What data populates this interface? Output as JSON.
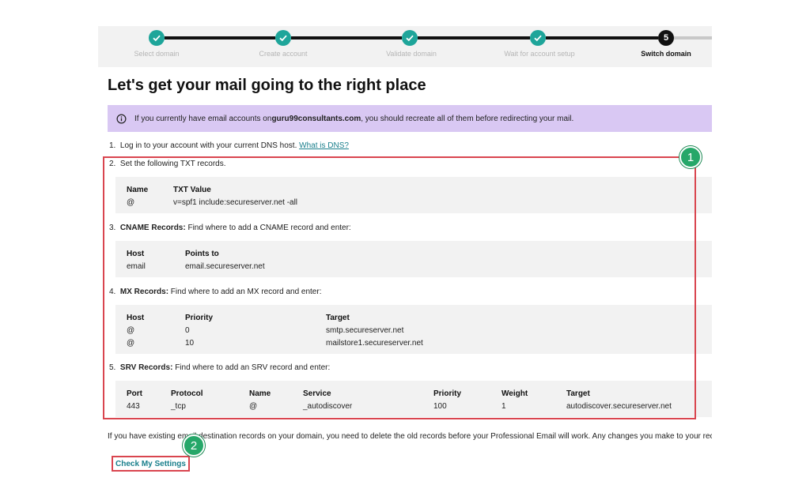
{
  "stepper": {
    "steps": [
      {
        "label": "Select domain",
        "state": "done"
      },
      {
        "label": "Create account",
        "state": "done"
      },
      {
        "label": "Validate domain",
        "state": "done"
      },
      {
        "label": "Wait for account setup",
        "state": "done"
      },
      {
        "label": "Switch domain",
        "state": "current",
        "number": "5"
      }
    ],
    "icon": "check-icon"
  },
  "page_title": "Let's get your mail going to the right place",
  "banner": {
    "icon": "info-icon",
    "prefix": "If you currently have email accounts on ",
    "domain": "guru99consultants.com",
    "suffix": ", you should recreate all of them before redirecting your mail."
  },
  "steps": {
    "s1": {
      "num": "1.",
      "text": "Log in to your account with your current DNS host. ",
      "link": "What is DNS?"
    },
    "s2": {
      "num": "2.",
      "text": "Set the following TXT records."
    },
    "s3": {
      "num": "3.",
      "bold": "CNAME Records:",
      "text": " Find where to add a CNAME record and enter:"
    },
    "s4": {
      "num": "4.",
      "bold": "MX Records:",
      "text": " Find where to add an MX record and enter:"
    },
    "s5": {
      "num": "5.",
      "bold": "SRV Records:",
      "text": " Find where to add an SRV record and enter:"
    }
  },
  "txt_table": {
    "headers": [
      "Name",
      "TXT Value"
    ],
    "rows": [
      [
        "@",
        "v=spf1 include:secureserver.net -all"
      ]
    ]
  },
  "cname_table": {
    "headers": [
      "Host",
      "Points to"
    ],
    "rows": [
      [
        "email",
        "email.secureserver.net"
      ]
    ]
  },
  "mx_table": {
    "headers": [
      "Host",
      "Priority",
      "Target"
    ],
    "rows": [
      [
        "@",
        "0",
        "smtp.secureserver.net"
      ],
      [
        "@",
        "10",
        "mailstore1.secureserver.net"
      ]
    ]
  },
  "srv_table": {
    "headers": [
      "Port",
      "Protocol",
      "Name",
      "Service",
      "Priority",
      "Weight",
      "Target"
    ],
    "rows": [
      [
        "443",
        "_tcp",
        "@",
        "_autodiscover",
        "100",
        "1",
        "autodiscover.secureserver.net"
      ]
    ]
  },
  "annotations": {
    "badge1": "1",
    "badge2": "2"
  },
  "footer": "If you have existing email destination records on your domain, you need to delete the old records before your Professional Email will work. Any changes you make to your records can",
  "check_button": "Check My Settings",
  "colors": {
    "accent": "#1ea59a",
    "link": "#1a7f8c",
    "banner": "#d9c8f3",
    "highlight": "#d9454f",
    "badge": "#26a769"
  }
}
